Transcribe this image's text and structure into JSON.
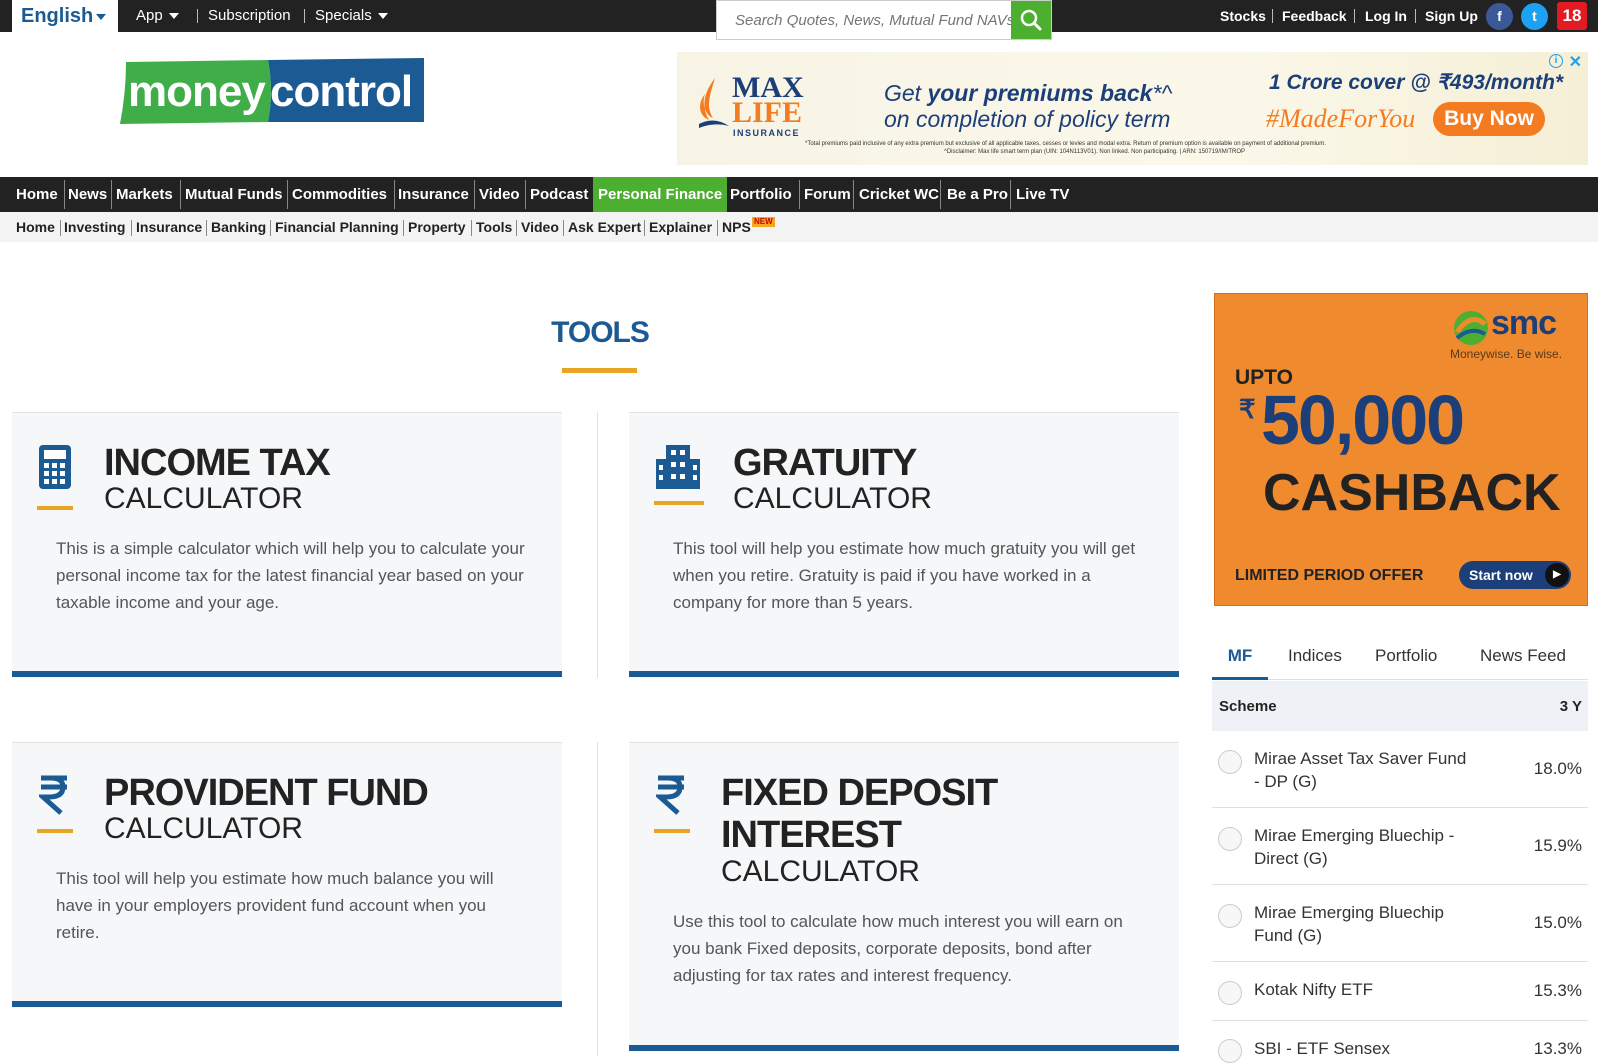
{
  "topbar": {
    "language": "English",
    "nav": [
      "App",
      "Subscription",
      "Specials"
    ],
    "search_placeholder": "Search Quotes, News, Mutual Fund NAVs",
    "right_links": [
      "Stocks",
      "Feedback",
      "Log In",
      "Sign Up"
    ],
    "social": [
      "f",
      "t",
      "18"
    ]
  },
  "logo": {
    "part1": "money",
    "part2": "control"
  },
  "ad": {
    "brand1": "MAX",
    "brand2": "LIFE",
    "brand3": "INSURANCE",
    "line1_a": "Get ",
    "line1_b": "your premiums back",
    "line1_c": "*^",
    "line2": "on completion of policy term",
    "cover": "1 Crore cover @ ₹493/month*",
    "hashtag": "#MadeForYou",
    "cta": "Buy Now",
    "fine1": "*Total premiums paid inclusive of any extra premium but exclusive of all applicable taxes, cesses or levies and modal extra. Return of premium option is available on payment of additional premium.",
    "fine2": "^Disclaimer: Max life smart term plan (UIN: 104N113V01). Non linked. Non participating. | ARN: 150719/IM/TROP"
  },
  "mainnav": [
    "Home",
    "News",
    "Markets",
    "Mutual Funds",
    "Commodities",
    "Insurance",
    "Video",
    "Podcast",
    "Personal Finance",
    "Portfolio",
    "Forum",
    "Cricket WC",
    "Be a Pro",
    "Live TV"
  ],
  "subnav": [
    "Home",
    "Investing",
    "Insurance",
    "Banking",
    "Financial Planning",
    "Property",
    "Tools",
    "Video",
    "Ask Expert",
    "Explainer",
    "NPS"
  ],
  "subnav_badge": "NEW",
  "tools": {
    "title": "TOOLS",
    "cards": [
      {
        "title": "INCOME TAX",
        "subtitle": "CALCULATOR",
        "desc": "This is a simple calculator which will help you to calculate your personal income tax for the latest financial year based on your taxable income and your age."
      },
      {
        "title": "GRATUITY",
        "subtitle": "CALCULATOR",
        "desc": "This tool will help you estimate how much gratuity you will get when you retire. Gratuity is paid if you have worked in a company for more than 5 years."
      },
      {
        "title": "PROVIDENT FUND",
        "subtitle": "CALCULATOR",
        "desc": "This tool will help you estimate how much balance you will have in your employers provident fund account when you retire."
      },
      {
        "title1": "FIXED DEPOSIT",
        "title2": "INTEREST",
        "subtitle": "CALCULATOR",
        "desc": "Use this tool to calculate how much interest you will earn on you bank Fixed deposits, corporate deposits, bond after adjusting for tax rates and interest frequency."
      }
    ]
  },
  "smc_ad": {
    "brand": "smc",
    "tagline": "Moneywise. Be wise.",
    "upto": "UPTO",
    "amount": "50,000",
    "rupee": "₹",
    "cashback": "CASHBACK",
    "limited": "LIMITED PERIOD OFFER",
    "cta": "Start now"
  },
  "widget": {
    "tabs": [
      "MF",
      "Indices",
      "Portfolio",
      "News Feed"
    ],
    "header": {
      "scheme": "Scheme",
      "period": "3 Y"
    },
    "rows": [
      {
        "name": "Mirae Asset Tax Saver Fund - DP (G)",
        "value": "18.0%"
      },
      {
        "name": "Mirae Emerging Bluechip -Direct (G)",
        "value": "15.9%"
      },
      {
        "name": "Mirae Emerging Bluechip Fund (G)",
        "value": "15.0%"
      },
      {
        "name": "Kotak Nifty ETF",
        "value": "15.3%"
      },
      {
        "name": "SBI - ETF Sensex",
        "value": "13.3%"
      }
    ]
  }
}
